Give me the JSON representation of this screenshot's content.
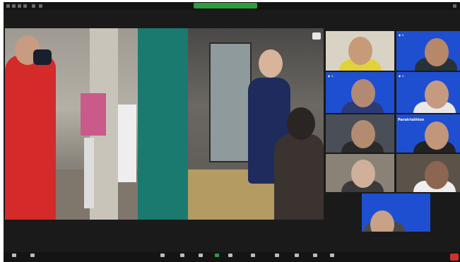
{
  "topbar": {
    "view_label": "",
    "extra_label": ""
  },
  "participants": [
    {
      "name": ""
    },
    {
      "name": ""
    },
    {
      "name": ""
    },
    {
      "name": ""
    },
    {
      "name": ""
    },
    {
      "name": ""
    },
    {
      "name": ""
    },
    {
      "name": ""
    },
    {
      "name": ""
    }
  ],
  "paratriathlon_label": "Paratriathlon",
  "toolbar": {
    "items": [
      {
        "label": ""
      },
      {
        "label": ""
      },
      {
        "label": ""
      },
      {
        "label": ""
      },
      {
        "label": ""
      },
      {
        "label": ""
      },
      {
        "label": ""
      },
      {
        "label": ""
      },
      {
        "label": ""
      },
      {
        "label": ""
      },
      {
        "label": ""
      },
      {
        "label": ""
      }
    ]
  },
  "colors": {
    "meeting_background": "#1a1a1a",
    "view_pill": "#2e9e3e",
    "tile_blue": "#1f4fd1",
    "end_button": "#d32f2f"
  },
  "icons": [
    "mute-icon",
    "video-icon",
    "security-icon",
    "participants-icon",
    "chat-icon",
    "polls-icon",
    "share-screen-icon",
    "record-icon",
    "breakout-icon",
    "reactions-icon",
    "apps-icon",
    "more-icon"
  ]
}
